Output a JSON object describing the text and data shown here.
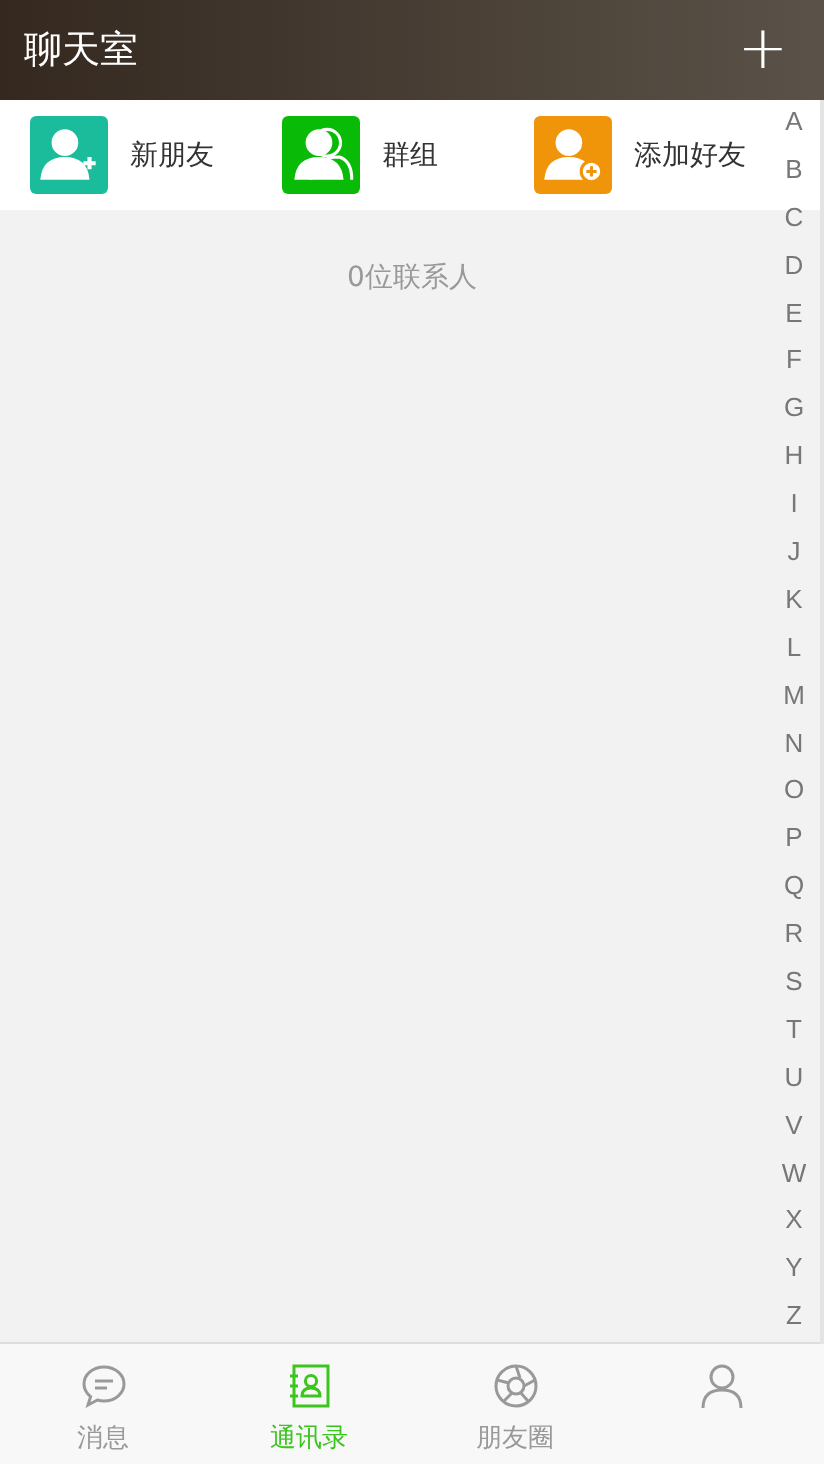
{
  "header": {
    "title": "聊天室",
    "add_button": "+"
  },
  "shortcuts": [
    {
      "kind": "new-friend",
      "label": "新朋友",
      "color": "#1abc9c"
    },
    {
      "kind": "group",
      "label": "群组",
      "color": "#09bb07"
    },
    {
      "kind": "add-friend",
      "label": "添加好友",
      "color": "#f0940a"
    }
  ],
  "contact_count": "0位联系人",
  "index_letters": [
    "A",
    "B",
    "C",
    "D",
    "E",
    "F",
    "G",
    "H",
    "I",
    "J",
    "K",
    "L",
    "M",
    "N",
    "O",
    "P",
    "Q",
    "R",
    "S",
    "T",
    "U",
    "V",
    "W",
    "X",
    "Y",
    "Z"
  ],
  "tabs": [
    {
      "kind": "chat",
      "label": "消息",
      "selected": false
    },
    {
      "kind": "contacts",
      "label": "通讯录",
      "selected": true
    },
    {
      "kind": "moments",
      "label": "朋友圈",
      "selected": false
    },
    {
      "kind": "me",
      "selected": false
    }
  ]
}
